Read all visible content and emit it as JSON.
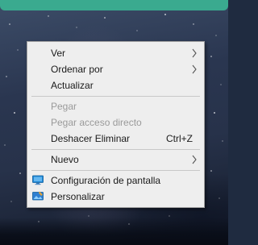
{
  "context_menu": {
    "items": [
      {
        "label": "Ver",
        "submenu": true,
        "enabled": true
      },
      {
        "label": "Ordenar por",
        "submenu": true,
        "enabled": true
      },
      {
        "label": "Actualizar",
        "submenu": false,
        "enabled": true
      },
      {
        "label": "Pegar",
        "submenu": false,
        "enabled": false
      },
      {
        "label": "Pegar acceso directo",
        "submenu": false,
        "enabled": false
      },
      {
        "label": "Deshacer Eliminar",
        "shortcut": "Ctrl+Z",
        "submenu": false,
        "enabled": true
      },
      {
        "label": "Nuevo",
        "submenu": true,
        "enabled": true
      },
      {
        "label": "Configuración de pantalla",
        "icon": "display-settings-icon",
        "submenu": false,
        "enabled": true
      },
      {
        "label": "Personalizar",
        "icon": "personalize-icon",
        "submenu": false,
        "enabled": true
      }
    ]
  },
  "colors": {
    "menu_background": "#eeeeee",
    "menu_text": "#1a1a1a",
    "disabled_text": "#9a9a9a",
    "separator": "#c8c8c8",
    "top_bar_accent": "#3aaa8f"
  }
}
